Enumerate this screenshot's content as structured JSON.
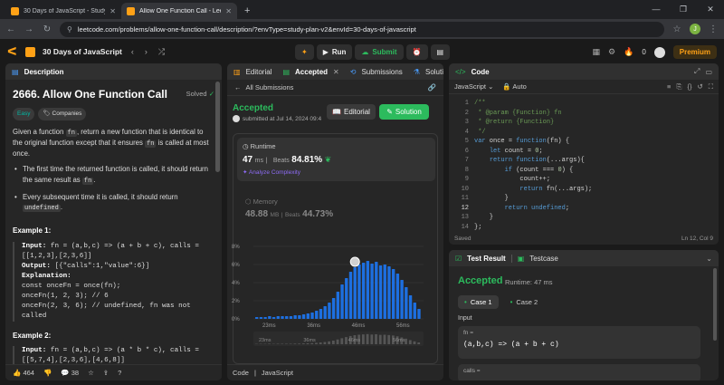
{
  "browser": {
    "tabs": [
      {
        "label": "30 Days of JavaScript - Study Pl",
        "active": false
      },
      {
        "label": "Allow One Function Call - LeetC",
        "active": true
      }
    ],
    "url": "leetcode.com/problems/allow-one-function-call/description/?envType=study-plan-v2&envId=30-days-of-javascript",
    "profile_initial": "J"
  },
  "toolbar": {
    "plan_name": "30 Days of JavaScript",
    "run_label": "Run",
    "submit_label": "Submit",
    "notif_count": "0",
    "premium_label": "Premium"
  },
  "description": {
    "tab_label": "Description",
    "title": "2666. Allow One Function Call",
    "solved_label": "Solved",
    "difficulty": "Easy",
    "companies_label": "Companies",
    "intro_1": "Given a function",
    "intro_code_1": "fn",
    "intro_2": ", return a new function that is identical to the original function except that it ensures",
    "intro_code_2": "fn",
    "intro_3": "is called at most once.",
    "bullet1_text": "The first time the returned function is called, it should return the same result as",
    "bullet1_code": "fn",
    "bullet2_text": "Every subsequent time it is called, it should return",
    "bullet2_code": "undefined",
    "example1_title": "Example 1:",
    "example1_lines": [
      "fn = (a,b,c) => (a + b + c), calls =",
      "[[1,2,3],[2,3,6]]",
      "[{\"calls\":1,\"value\":6}]",
      "const onceFn = once(fn);",
      "onceFn(1, 2, 3); // 6",
      "onceFn(2, 3, 6); // undefined, fn was not",
      "called"
    ],
    "input_label": "Input:",
    "output_label": "Output:",
    "explanation_label": "Explanation:",
    "example2_title": "Example 2:",
    "example2_lines": [
      "fn = (a,b,c) => (a * b * c), calls =",
      "[[5,7,4],[2,3,6],[4,6,8]]"
    ],
    "likes": "464",
    "comments": "38"
  },
  "submission": {
    "tabs": [
      "Editorial",
      "Accepted",
      "Submissions",
      "Solutions"
    ],
    "all_label": "All Submissions",
    "status": "Accepted",
    "submitted_text": "submitted at Jul 14, 2024 09:4",
    "editorial_btn": "Editorial",
    "solution_btn": "Solution",
    "runtime_label": "Runtime",
    "runtime_value": "47",
    "runtime_unit": "ms",
    "beats_label": "Beats",
    "runtime_beats": "84.81%",
    "analyze_label": "Analyze Complexity",
    "memory_label": "Memory",
    "memory_value": "48.88",
    "memory_unit": "MB",
    "memory_beats": "44.73%",
    "footer_code": "Code",
    "footer_lang": "JavaScript"
  },
  "chart_data": {
    "type": "bar",
    "title": "",
    "xlabel": "",
    "ylabel": "",
    "ylim": [
      0,
      8
    ],
    "yticks": [
      "0%",
      "2%",
      "4%",
      "6%",
      "8%"
    ],
    "xticks": [
      "23ms",
      "36ms",
      "46ms",
      "56ms"
    ],
    "highlight_index": 23,
    "values": [
      0.2,
      0.2,
      0.2,
      0.3,
      0.2,
      0.3,
      0.3,
      0.3,
      0.3,
      0.4,
      0.4,
      0.5,
      0.6,
      0.7,
      0.9,
      1.1,
      1.4,
      1.8,
      2.3,
      3.0,
      3.8,
      4.5,
      5.2,
      5.7,
      6.0,
      6.2,
      6.4,
      6.1,
      6.3,
      5.9,
      6.0,
      5.8,
      5.5,
      5.0,
      4.3,
      3.5,
      2.6,
      1.8,
      1.1
    ],
    "grid": true
  },
  "code": {
    "tab_label": "Code",
    "language": "JavaScript",
    "mode": "Auto",
    "line_numbers": [
      "1",
      "2",
      "3",
      "4",
      "5",
      "6",
      "7",
      "8",
      "9",
      "10",
      "11",
      "12",
      "13",
      "14"
    ],
    "lines": [
      "/**",
      " * @param {Function} fn",
      " * @return {Function}",
      " */",
      "var once = function(fn) {",
      "    let count = 0;",
      "    return function(...args){",
      "        if (count === 0) {",
      "            count++;",
      "            return fn(...args);",
      "        }",
      "        return undefined;",
      "    }",
      "};"
    ],
    "saved_label": "Saved",
    "cursor_pos": "Ln 12, Col 9"
  },
  "test": {
    "tab_result": "Test Result",
    "tab_testcase": "Testcase",
    "status": "Accepted",
    "runtime": "Runtime: 47 ms",
    "case1": "Case 1",
    "case2": "Case 2",
    "input_label": "Input",
    "fn_key": "fn =",
    "fn_value": "(a,b,c) => (a + b + c)",
    "calls_key": "calls ="
  },
  "colors": {
    "accent": "#ffa116",
    "accepted": "#2cbb5d",
    "bar": "#1d6fe0",
    "panel": "#262626"
  }
}
